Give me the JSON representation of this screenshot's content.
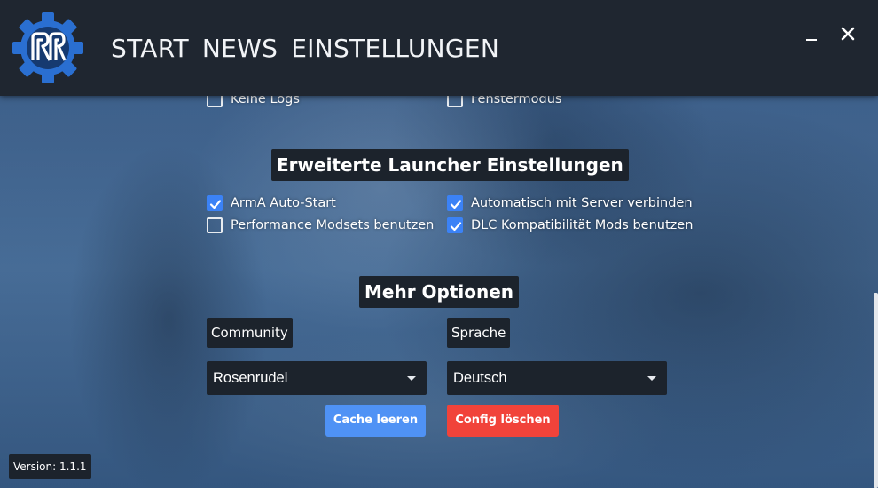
{
  "nav": {
    "items": [
      {
        "label": "START"
      },
      {
        "label": "NEWS"
      },
      {
        "label": "EINSTELLUNGEN"
      }
    ]
  },
  "window": {
    "minimize_icon": "minimize-icon",
    "close_icon": "close-icon"
  },
  "logging": {
    "options": [
      {
        "label": "Keine Logs",
        "checked": false
      },
      {
        "label": "Fenstermodus",
        "checked": false
      }
    ]
  },
  "launcher_settings": {
    "title": "Erweiterte Launcher Einstellungen",
    "options": [
      {
        "label": "ArmA Auto-Start",
        "checked": true
      },
      {
        "label": "Automatisch mit Server verbinden",
        "checked": true
      },
      {
        "label": "Performance Modsets benutzen",
        "checked": false
      },
      {
        "label": "DLC Kompatibilität Mods benutzen",
        "checked": true
      }
    ]
  },
  "more_options": {
    "title": "Mehr Optionen",
    "community": {
      "label": "Community",
      "value": "Rosenrudel"
    },
    "language": {
      "label": "Sprache",
      "value": "Deutsch"
    },
    "clear_cache_label": "Cache leeren",
    "delete_config_label": "Config löschen"
  },
  "version": "Version: 1.1.1",
  "colors": {
    "topbar": "#1f2630",
    "panel": "#1c232c",
    "checkbox_checked": "#3b82f6",
    "button_blue": "#4f92f5",
    "button_red": "#f1433a"
  }
}
